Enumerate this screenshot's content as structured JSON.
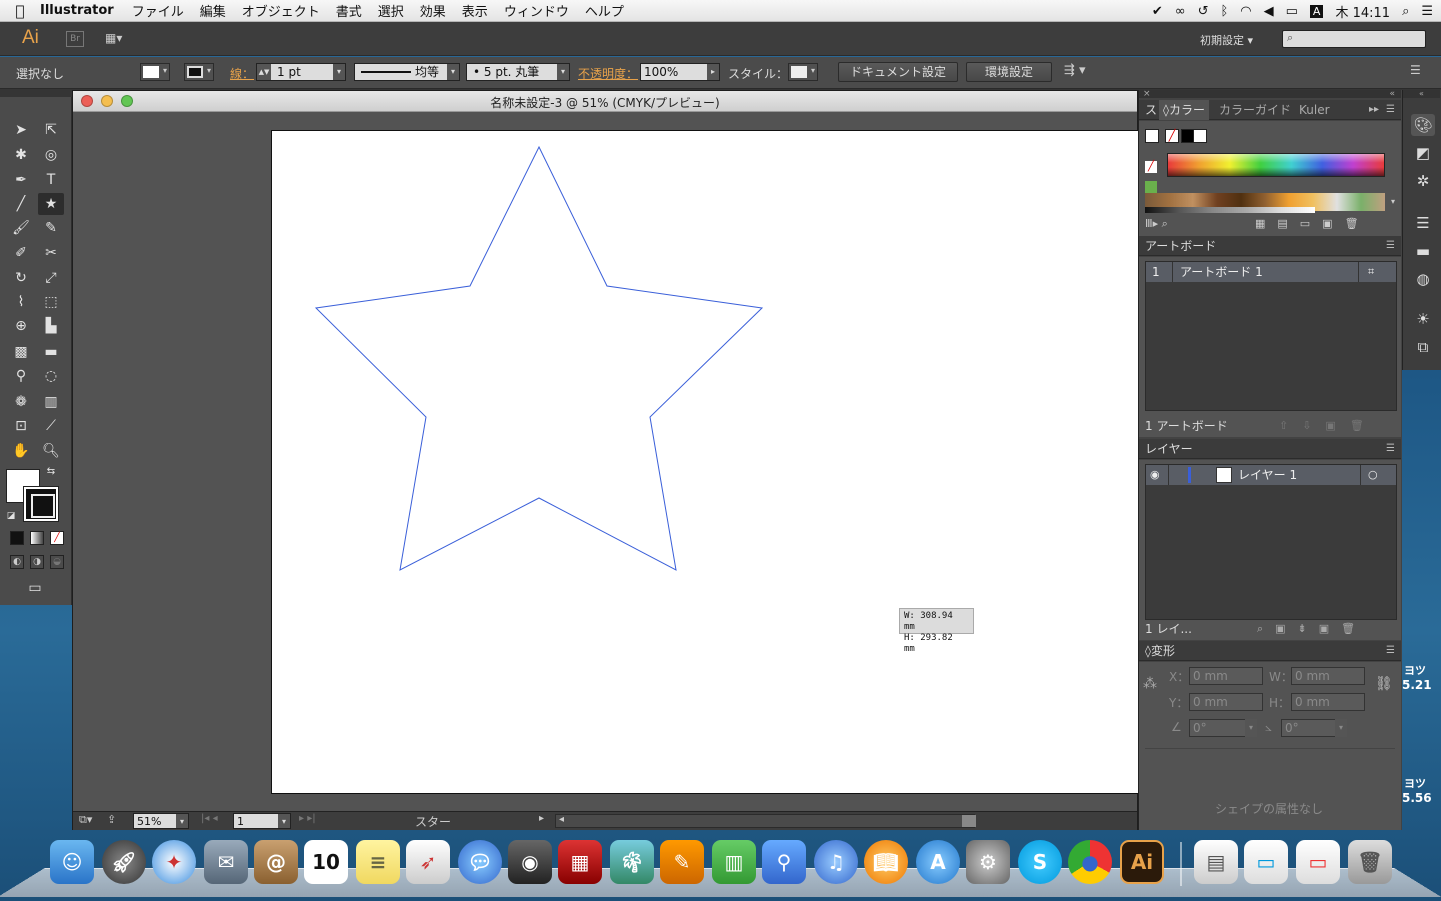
{
  "menubar": {
    "app_name": "Illustrator",
    "items": [
      "ファイル",
      "編集",
      "オブジェクト",
      "書式",
      "選択",
      "効果",
      "表示",
      "ウィンドウ",
      "ヘルプ"
    ],
    "clock": "木 14:11",
    "input_source": "A"
  },
  "appbar": {
    "logo": "Ai",
    "bridge": "Br",
    "workspace": "初期設定"
  },
  "controlbar": {
    "selection": "選択なし",
    "stroke_label": "線：",
    "stroke_weight": "1 pt",
    "profile": "均等",
    "brush": "5 pt. 丸筆",
    "opacity_label": "不透明度：",
    "opacity": "100%",
    "style_label": "スタイル：",
    "doc_setup": "ドキュメント設定",
    "prefs": "環境設定"
  },
  "document": {
    "title": "名称未設定-3 @ 51% (CMYK/プレビュー)",
    "tooltip_w": "W: 308.94 mm",
    "tooltip_h": "H: 293.82 mm",
    "zoom": "51%",
    "artboard_num": "1",
    "status": "スター"
  },
  "panels": {
    "color_tab_short": "ス",
    "color_tab": "カラー",
    "color_guide_tab": "カラーガイド",
    "kuler_tab": "Kuler",
    "artboards_title": "アートボード",
    "artboard_row_num": "1",
    "artboard_row_name": "アートボード 1",
    "artboards_footer": "1 アートボード",
    "layers_title": "レイヤー",
    "layer_row_name": "レイヤー 1",
    "layers_footer": "1 レイ...",
    "transform_title": "変形",
    "x_label": "X：",
    "y_label": "Y：",
    "w_label": "W：",
    "h_label": "H：",
    "x_val": "0 mm",
    "y_val": "0 mm",
    "w_val": "0 mm",
    "h_val": "0 mm",
    "angle_val": "0°",
    "shear_val": "0°",
    "no_shape": "シェイプの属性なし"
  },
  "desktop": {
    "text1": "ヨツ",
    "num1": "5.21",
    "text2": "ヨツ",
    "num2": "5.56"
  },
  "dock": {
    "calendar_day": "10",
    "ai_label": "Ai"
  },
  "colors": {
    "star_stroke": "#3a5fd9",
    "ai_orange": "#e8a24a",
    "selected_row": "#595d65"
  }
}
